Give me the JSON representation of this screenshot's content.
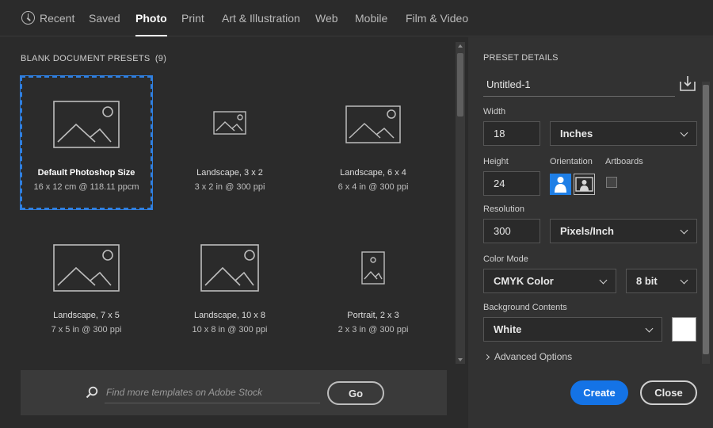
{
  "tabs": [
    {
      "label": "Recent",
      "icon": "clock-icon"
    },
    {
      "label": "Saved"
    },
    {
      "label": "Photo",
      "active": true
    },
    {
      "label": "Print"
    },
    {
      "label": "Art & Illustration"
    },
    {
      "label": "Web"
    },
    {
      "label": "Mobile"
    },
    {
      "label": "Film & Video"
    }
  ],
  "presets": {
    "title": "BLANK DOCUMENT PRESETS",
    "count": "(9)",
    "items": [
      {
        "name": "Default Photoshop Size",
        "dims": "16 x 12 cm @ 118.11 ppcm",
        "icon": "image-landscape-icon",
        "selected": true
      },
      {
        "name": "Landscape, 3 x 2",
        "dims": "3 x 2 in @ 300 ppi",
        "icon": "image-landscape-icon"
      },
      {
        "name": "Landscape, 6 x 4",
        "dims": "6 x 4 in @ 300 ppi",
        "icon": "image-landscape-icon"
      },
      {
        "name": "Landscape, 7 x 5",
        "dims": "7 x 5 in @ 300 ppi",
        "icon": "image-landscape-icon"
      },
      {
        "name": "Landscape, 10 x 8",
        "dims": "10 x 8 in @ 300 ppi",
        "icon": "image-landscape-icon"
      },
      {
        "name": "Portrait, 2 x 3",
        "dims": "2 x 3 in @ 300 ppi",
        "icon": "image-portrait-icon"
      }
    ]
  },
  "search": {
    "placeholder": "Find more templates on Adobe Stock",
    "go_label": "Go"
  },
  "details": {
    "title": "PRESET DETAILS",
    "doc_name": "Untitled-1",
    "width_label": "Width",
    "width_value": "18",
    "width_unit": "Inches",
    "height_label": "Height",
    "height_value": "24",
    "orientation_label": "Orientation",
    "orientation": "portrait",
    "artboards_label": "Artboards",
    "artboards_checked": false,
    "resolution_label": "Resolution",
    "resolution_value": "300",
    "resolution_unit": "Pixels/Inch",
    "color_mode_label": "Color Mode",
    "color_mode": "CMYK Color",
    "bit_depth": "8 bit",
    "bg_label": "Background Contents",
    "bg_value": "White",
    "bg_color": "#ffffff",
    "advanced_label": "Advanced Options"
  },
  "actions": {
    "create_label": "Create",
    "close_label": "Close",
    "accent": "#1473e6"
  }
}
